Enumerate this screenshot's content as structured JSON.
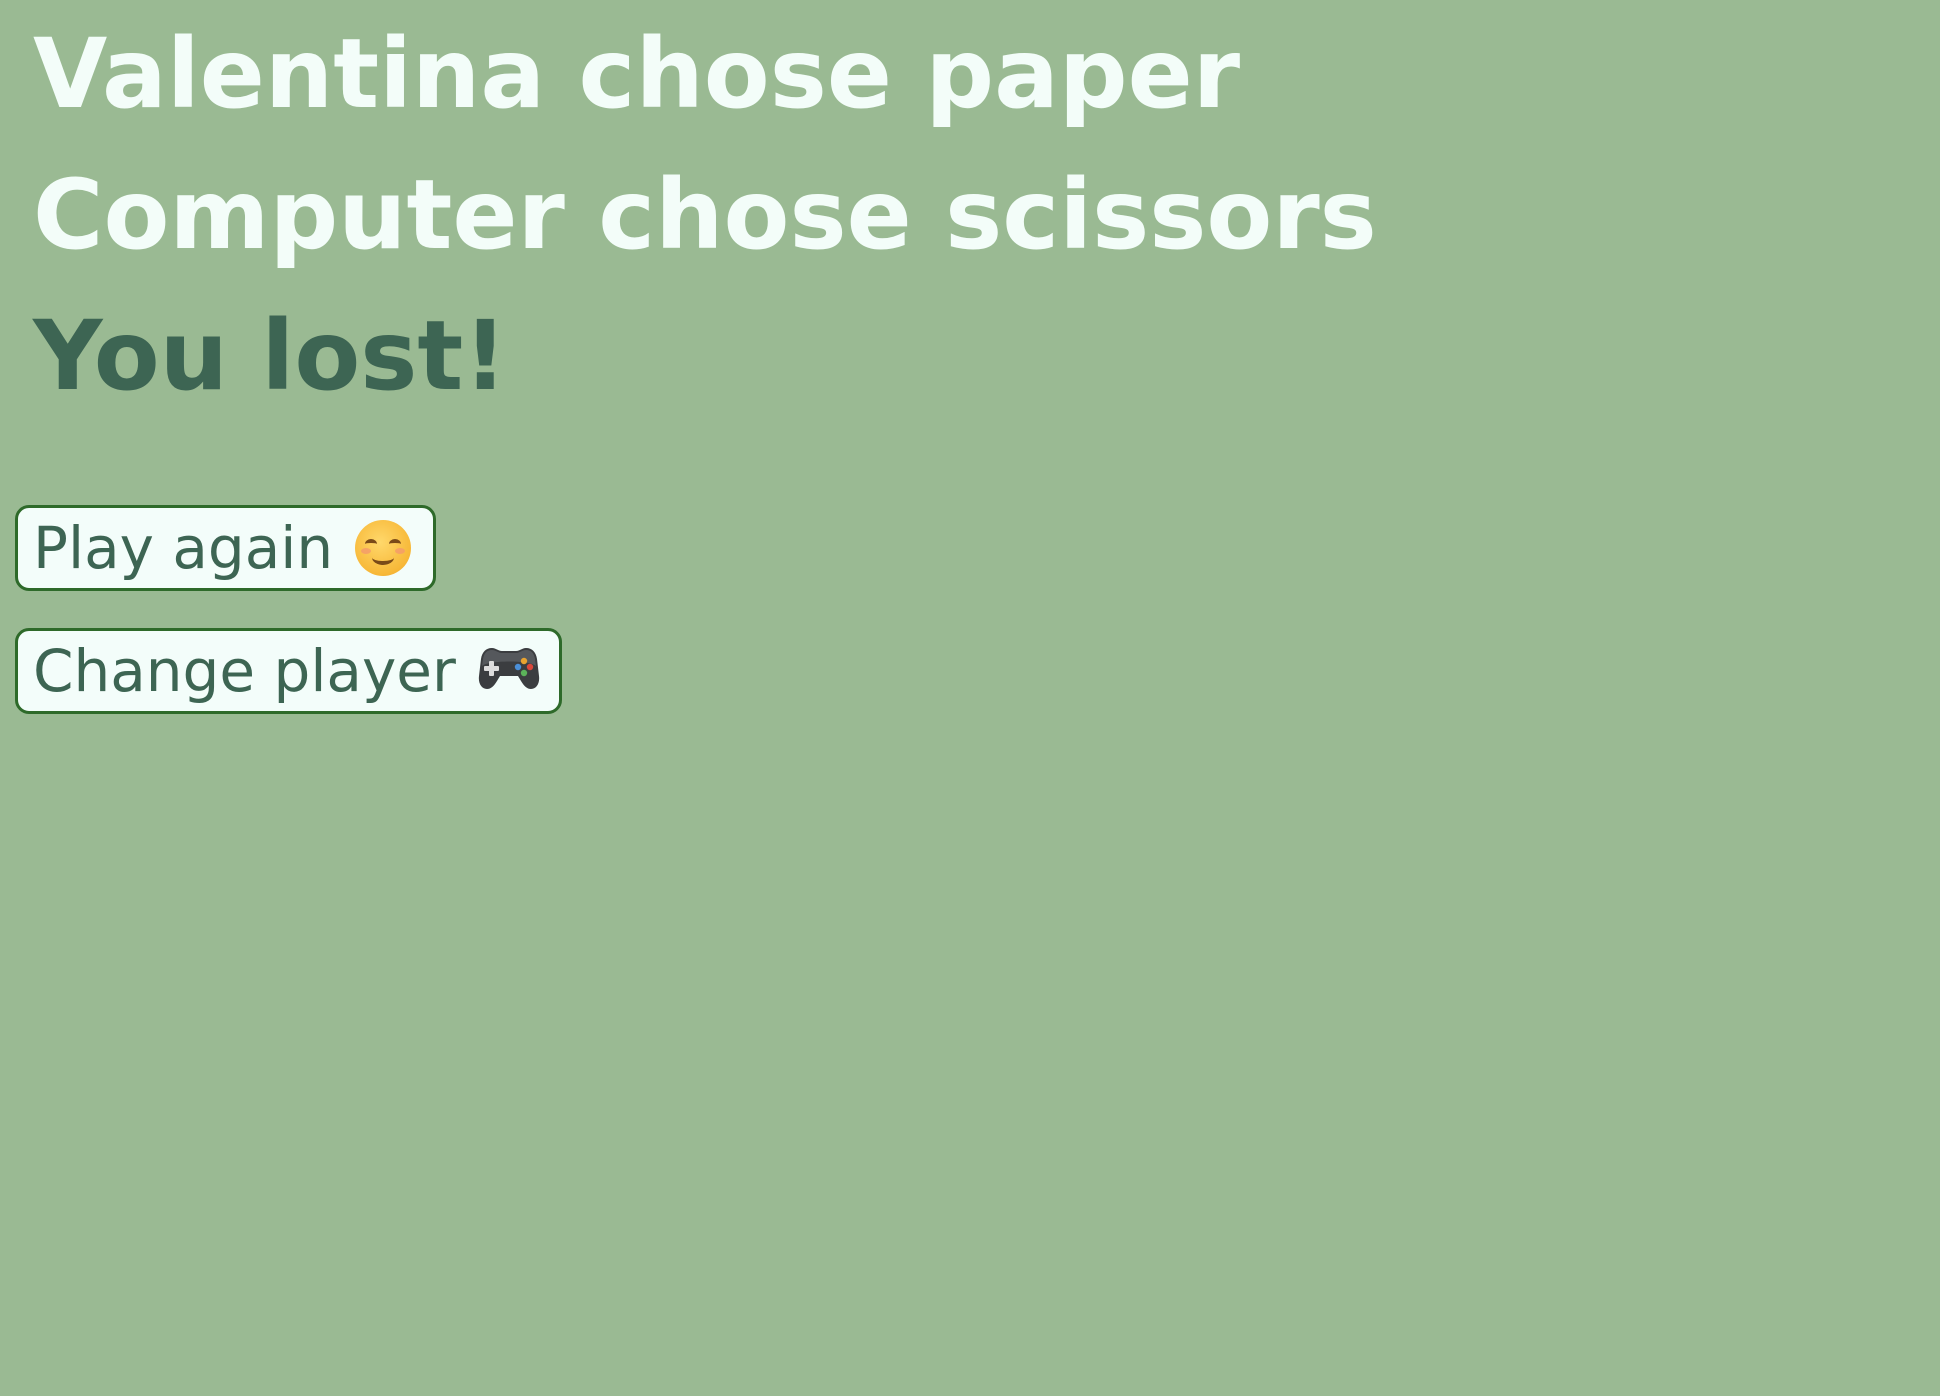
{
  "result": {
    "player_line": "Valentina chose paper",
    "computer_line": "Computer chose scissors",
    "outcome": "You lost!"
  },
  "buttons": {
    "play_again_label": "Play again",
    "play_again_icon": "smiling-face-icon",
    "change_player_label": "Change player",
    "change_player_icon": "game-controller-icon"
  },
  "colors": {
    "background": "#9aba93",
    "light_text": "#f3fdf9",
    "dark_text": "#3d6553",
    "button_border": "#2e6a2a",
    "button_background": "#f3fdfa"
  }
}
